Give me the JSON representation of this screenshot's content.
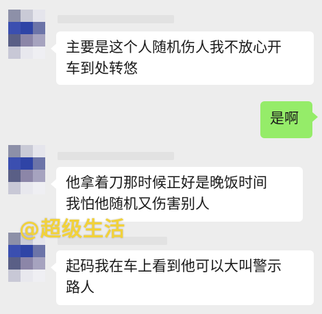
{
  "messages": [
    {
      "side": "in",
      "text": "主要是这个人随机伤人我不放心开\n车到处转悠"
    },
    {
      "side": "out",
      "text": "是啊"
    },
    {
      "side": "in",
      "text": "他拿着刀那时候正好是晚饭时间\n我怕他随机又伤害别人"
    },
    {
      "side": "in",
      "text": "起码我在车上看到他可以大叫警示\n路人"
    }
  ],
  "watermark": "@超级生活",
  "colors": {
    "background": "#ededed",
    "incoming_bubble": "#ffffff",
    "outgoing_bubble": "#95ec69",
    "watermark": "#f2d23a"
  }
}
